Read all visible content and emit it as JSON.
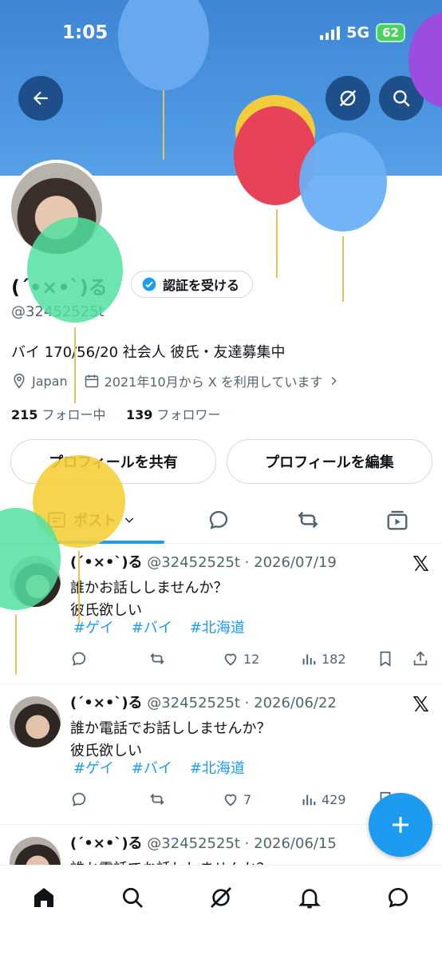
{
  "status_bar": {
    "time": "1:05",
    "network": "5G",
    "battery": "62"
  },
  "profile": {
    "name": "(´•×•`)る",
    "verify_label": "認証を受ける",
    "handle": "@32452525t",
    "bio": "バイ 170/56/20 社会人 彼氏・友達募集中",
    "location": "Japan",
    "joined": "2021年10月から X を利用しています",
    "following_count": "215",
    "following_label": "フォロー中",
    "followers_count": "139",
    "followers_label": "フォロワー"
  },
  "buttons": {
    "share": "プロフィールを共有",
    "edit": "プロフィールを編集"
  },
  "tabs": {
    "posts_label": "ポスト"
  },
  "posts": [
    {
      "name": "(´•×•`)る",
      "meta": "@32452525t · 2026/07/19",
      "line1": "誰かお話ししませんか？",
      "line2": "彼氏欲しい",
      "tags": [
        "#ゲイ",
        "#バイ",
        "#北海道"
      ],
      "likes": "12",
      "views": "182"
    },
    {
      "name": "(´•×•`)る",
      "meta": "@32452525t · 2026/06/22",
      "line1": "誰か電話でお話ししませんか？",
      "line2": "彼氏欲しい",
      "tags": [
        "#ゲイ",
        "#バイ",
        "#北海道"
      ],
      "likes": "7",
      "views": "429"
    },
    {
      "name": "(´•×•`)る",
      "meta": "@32452525t · 2026/06/15",
      "line1": "誰か電話でお話ししませんか？"
    }
  ],
  "colors": {
    "accent": "#1d9bf0",
    "banner": "#4a95e0"
  }
}
